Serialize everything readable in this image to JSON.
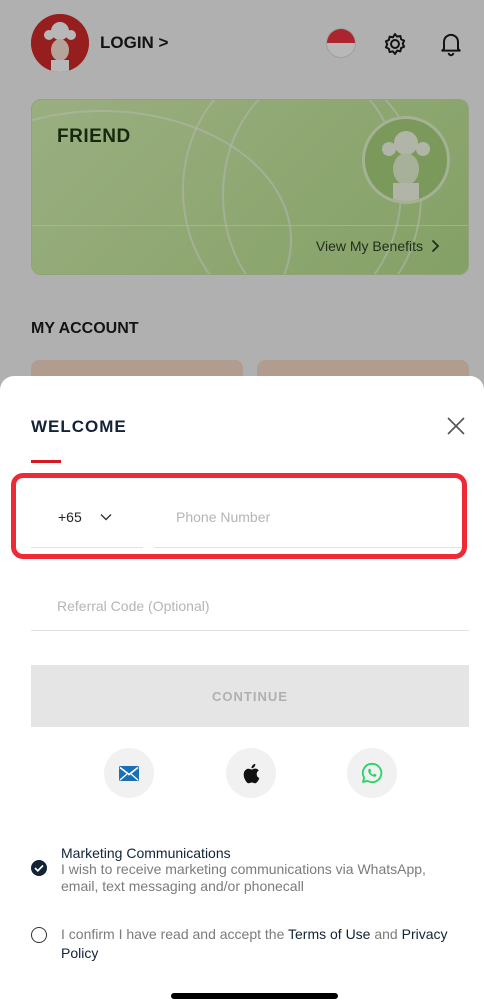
{
  "header": {
    "login_label": "LOGIN >"
  },
  "member_card": {
    "tier": "FRIEND",
    "benefits_label": "View My Benefits"
  },
  "account": {
    "section_title": "MY ACCOUNT"
  },
  "sheet": {
    "title": "WELCOME",
    "country_code": "+65",
    "phone_placeholder": "Phone Number",
    "referral_placeholder": "Referral Code (Optional)",
    "continue_label": "CONTINUE",
    "social_buttons": [
      "mail-icon",
      "apple-icon",
      "whatsapp-icon"
    ],
    "marketing": {
      "title": "Marketing Communications",
      "description": "I wish to receive marketing communications via WhatsApp, email, text messaging and/or phonecall",
      "checked": true
    },
    "terms": {
      "prefix": "I confirm I have read and accept the",
      "terms_link": "Terms of Use",
      "middle": "and",
      "privacy_link": "Privacy Policy",
      "checked": false
    }
  },
  "colors": {
    "brand_red": "#d71920",
    "navy": "#142238",
    "highlight": "#ee2a36",
    "whatsapp": "#25d366",
    "mail_blue": "#1a6fb5"
  }
}
